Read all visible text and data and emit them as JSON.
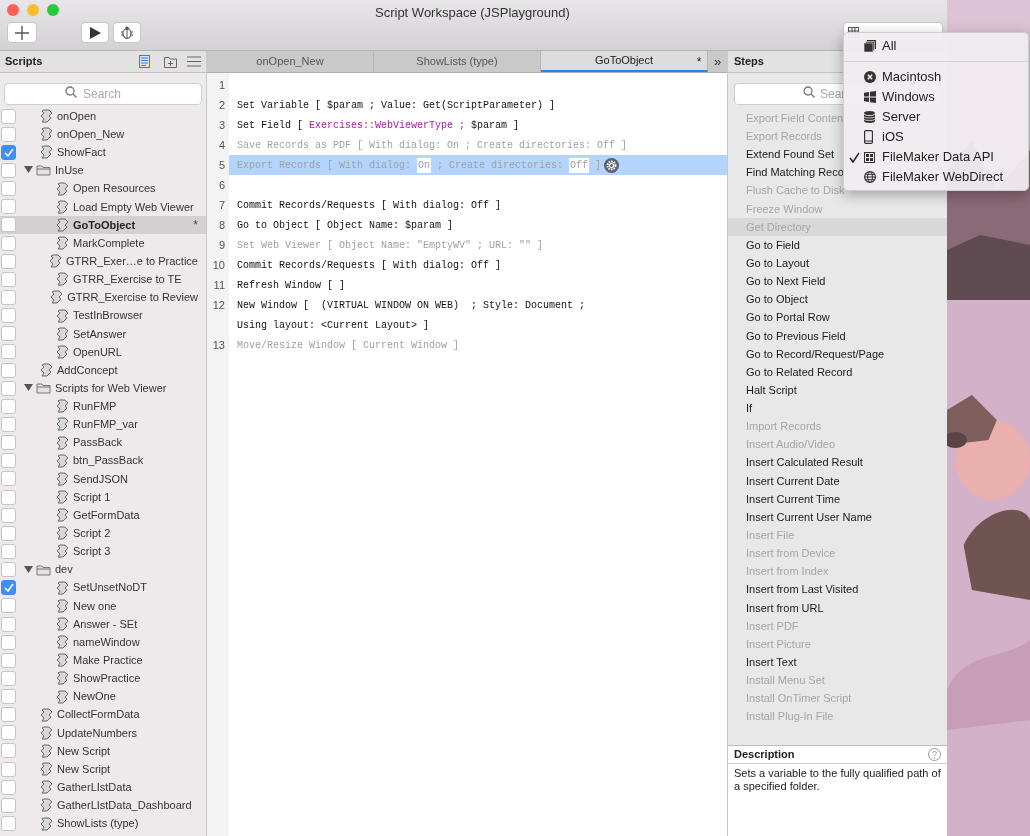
{
  "window": {
    "title": "Script Workspace (JSPlayground)"
  },
  "sidebar": {
    "title": "Scripts",
    "search": {
      "placeholder": "Search"
    },
    "items": [
      {
        "kind": "script",
        "name": "onOpen",
        "checked": false,
        "selected": false
      },
      {
        "kind": "script",
        "name": "onOpen_New",
        "checked": false,
        "selected": false
      },
      {
        "kind": "script",
        "name": "ShowFact",
        "checked": true,
        "selected": false
      },
      {
        "kind": "folder",
        "name": "InUse",
        "checked": false,
        "selected": false,
        "expanded": true,
        "children": [
          {
            "kind": "script",
            "name": "Open Resources",
            "checked": false,
            "selected": false
          },
          {
            "kind": "script",
            "name": "Load Empty Web Viewer",
            "checked": false,
            "selected": false
          },
          {
            "kind": "script",
            "name": "GoToObject",
            "checked": false,
            "selected": true,
            "mark": "*"
          },
          {
            "kind": "script",
            "name": "MarkComplete",
            "checked": false,
            "selected": false
          },
          {
            "kind": "script",
            "name": "GTRR_Exer…e to Practice",
            "checked": false,
            "selected": false
          },
          {
            "kind": "script",
            "name": "GTRR_Exercise to TE",
            "checked": false,
            "selected": false
          },
          {
            "kind": "script",
            "name": "GTRR_Exercise to Review",
            "checked": false,
            "selected": false
          },
          {
            "kind": "script",
            "name": "TestInBrowser",
            "checked": false,
            "selected": false
          },
          {
            "kind": "script",
            "name": "SetAnswer",
            "checked": false,
            "selected": false
          },
          {
            "kind": "script",
            "name": "OpenURL",
            "checked": false,
            "selected": false
          }
        ]
      },
      {
        "kind": "script",
        "name": "AddConcept",
        "checked": false,
        "selected": false
      },
      {
        "kind": "folder",
        "name": "Scripts for Web Viewer",
        "checked": false,
        "selected": false,
        "expanded": true,
        "children": [
          {
            "kind": "script",
            "name": "RunFMP",
            "checked": false,
            "selected": false
          },
          {
            "kind": "script",
            "name": "RunFMP_var",
            "checked": false,
            "selected": false
          },
          {
            "kind": "script",
            "name": "PassBack",
            "checked": false,
            "selected": false
          },
          {
            "kind": "script",
            "name": "btn_PassBack",
            "checked": false,
            "selected": false
          },
          {
            "kind": "script",
            "name": "SendJSON",
            "checked": false,
            "selected": false
          },
          {
            "kind": "script",
            "name": "Script 1",
            "checked": false,
            "selected": false
          },
          {
            "kind": "script",
            "name": "GetFormData",
            "checked": false,
            "selected": false
          },
          {
            "kind": "script",
            "name": "Script 2",
            "checked": false,
            "selected": false
          },
          {
            "kind": "script",
            "name": "Script 3",
            "checked": false,
            "selected": false
          }
        ]
      },
      {
        "kind": "folder",
        "name": "dev",
        "checked": false,
        "selected": false,
        "expanded": true,
        "children": [
          {
            "kind": "script",
            "name": "SetUnsetNoDT",
            "checked": true,
            "selected": false
          },
          {
            "kind": "script",
            "name": "New one",
            "checked": false,
            "selected": false
          },
          {
            "kind": "script",
            "name": "Answer - SEt",
            "checked": false,
            "selected": false
          },
          {
            "kind": "script",
            "name": "nameWindow",
            "checked": false,
            "selected": false
          },
          {
            "kind": "script",
            "name": "Make Practice",
            "checked": false,
            "selected": false
          },
          {
            "kind": "script",
            "name": "ShowPractice",
            "checked": false,
            "selected": false
          },
          {
            "kind": "script",
            "name": "NewOne",
            "checked": false,
            "selected": false
          }
        ]
      },
      {
        "kind": "script",
        "name": "CollectFormData",
        "checked": false,
        "selected": false
      },
      {
        "kind": "script",
        "name": "UpdateNumbers",
        "checked": false,
        "selected": false
      },
      {
        "kind": "script",
        "name": "New Script",
        "checked": false,
        "selected": false
      },
      {
        "kind": "script",
        "name": "New Script",
        "checked": false,
        "selected": false
      },
      {
        "kind": "script",
        "name": "GatherLIstData",
        "checked": false,
        "selected": false
      },
      {
        "kind": "script",
        "name": "GatherLIstData_Dashboard",
        "checked": false,
        "selected": false
      },
      {
        "kind": "script",
        "name": "ShowLists (type)",
        "checked": false,
        "selected": false
      }
    ]
  },
  "tabs": [
    {
      "label": "onOpen_New",
      "selected": false
    },
    {
      "label": "ShowLists (type)",
      "selected": false
    },
    {
      "label": "GoToObject",
      "selected": true,
      "mark": "*"
    }
  ],
  "tabs_overflow": "»",
  "editor": {
    "lines": [
      {
        "number": "1",
        "selected": false,
        "rows": [
          []
        ]
      },
      {
        "number": "2",
        "disabled": false,
        "selected": false,
        "rows": [
          [
            {
              "kind": "plain",
              "text": "Set Variable [ $param ; Value: Get(ScriptParameter) ]"
            }
          ]
        ]
      },
      {
        "number": "3",
        "disabled": false,
        "selected": false,
        "rows": [
          [
            {
              "kind": "plain",
              "text": "Set Field [ "
            },
            {
              "kind": "field",
              "text": "Exercises::WebViewerType ;"
            },
            {
              "kind": "plain",
              "text": " $param ]"
            }
          ]
        ]
      },
      {
        "number": "4",
        "disabled": true,
        "selected": false,
        "rows": [
          [
            {
              "kind": "plain",
              "text": "Save Records as PDF [ With dialog: On ; Create directories: Off ]"
            }
          ]
        ]
      },
      {
        "number": "5",
        "disabled": true,
        "selected": true,
        "rows": [
          [
            {
              "kind": "plain",
              "text": "Export Records [ With dialog: "
            },
            {
              "kind": "option",
              "text": "On"
            },
            {
              "kind": "plain",
              "text": " ; Create directories: "
            },
            {
              "kind": "option",
              "text": "Off"
            },
            {
              "kind": "plain",
              "text": " ]"
            }
          ]
        ]
      },
      {
        "number": "6",
        "selected": false,
        "rows": [
          []
        ]
      },
      {
        "number": "7",
        "disabled": false,
        "selected": false,
        "rows": [
          [
            {
              "kind": "plain",
              "text": "Commit Records/Requests [ With dialog: Off ]"
            }
          ]
        ]
      },
      {
        "number": "8",
        "disabled": false,
        "selected": false,
        "rows": [
          [
            {
              "kind": "plain",
              "text": "Go to Object [ Object Name: $param ]"
            }
          ]
        ]
      },
      {
        "number": "9",
        "disabled": true,
        "selected": false,
        "rows": [
          [
            {
              "kind": "plain",
              "text": "Set Web Viewer [ Object Name: \"EmptyWV\" ; URL: \"\" ]"
            }
          ]
        ]
      },
      {
        "number": "10",
        "disabled": false,
        "selected": false,
        "rows": [
          [
            {
              "kind": "plain",
              "text": "Commit Records/Requests [ With dialog: Off ]"
            }
          ]
        ]
      },
      {
        "number": "11",
        "disabled": false,
        "selected": false,
        "rows": [
          [
            {
              "kind": "plain",
              "text": "Refresh Window [ ]"
            }
          ]
        ]
      },
      {
        "number": "12",
        "disabled": false,
        "selected": false,
        "rows": [
          [
            {
              "kind": "plain",
              "text": "New Window [  (VIRTUAL WINDOW ON WEB)  ; Style: Document ;"
            }
          ],
          [
            {
              "kind": "plain",
              "text": "Using layout: <Current Layout> ]"
            }
          ]
        ]
      },
      {
        "number": "13",
        "disabled": true,
        "selected": false,
        "rows": [
          [
            {
              "kind": "plain",
              "text": "Move/Resize Window [ Current Window ]"
            }
          ]
        ]
      }
    ]
  },
  "steps": {
    "title": "Steps",
    "search": {
      "placeholder": "Sear"
    },
    "items": [
      {
        "label": "Export Field Conten",
        "disabled": true,
        "selected": false
      },
      {
        "label": "Export Records",
        "disabled": true,
        "selected": false
      },
      {
        "label": "Extend Found Set",
        "disabled": false,
        "selected": false
      },
      {
        "label": "Find Matching Reco",
        "disabled": false,
        "selected": false
      },
      {
        "label": "Flush Cache to Disk",
        "disabled": true,
        "selected": false
      },
      {
        "label": "Freeze Window",
        "disabled": true,
        "selected": false
      },
      {
        "label": "Get Directory",
        "disabled": true,
        "selected": true
      },
      {
        "label": "Go to Field",
        "disabled": false,
        "selected": false
      },
      {
        "label": "Go to Layout",
        "disabled": false,
        "selected": false
      },
      {
        "label": "Go to Next Field",
        "disabled": false,
        "selected": false
      },
      {
        "label": "Go to Object",
        "disabled": false,
        "selected": false
      },
      {
        "label": "Go to Portal Row",
        "disabled": false,
        "selected": false
      },
      {
        "label": "Go to Previous Field",
        "disabled": false,
        "selected": false
      },
      {
        "label": "Go to Record/Request/Page",
        "disabled": false,
        "selected": false
      },
      {
        "label": "Go to Related Record",
        "disabled": false,
        "selected": false
      },
      {
        "label": "Halt Script",
        "disabled": false,
        "selected": false
      },
      {
        "label": "If",
        "disabled": false,
        "selected": false
      },
      {
        "label": "Import Records",
        "disabled": true,
        "selected": false
      },
      {
        "label": "Insert Audio/Video",
        "disabled": true,
        "selected": false
      },
      {
        "label": "Insert Calculated Result",
        "disabled": false,
        "selected": false
      },
      {
        "label": "Insert Current Date",
        "disabled": false,
        "selected": false
      },
      {
        "label": "Insert Current Time",
        "disabled": false,
        "selected": false
      },
      {
        "label": "Insert Current User Name",
        "disabled": false,
        "selected": false
      },
      {
        "label": "Insert File",
        "disabled": true,
        "selected": false
      },
      {
        "label": "Insert from Device",
        "disabled": true,
        "selected": false
      },
      {
        "label": "Insert from Index",
        "disabled": true,
        "selected": false
      },
      {
        "label": "Insert from Last Visited",
        "disabled": false,
        "selected": false
      },
      {
        "label": "Insert from URL",
        "disabled": false,
        "selected": false
      },
      {
        "label": "Insert PDF",
        "disabled": true,
        "selected": false
      },
      {
        "label": "Insert Picture",
        "disabled": true,
        "selected": false
      },
      {
        "label": "Insert Text",
        "disabled": false,
        "selected": false
      },
      {
        "label": "Install Menu Set",
        "disabled": true,
        "selected": false
      },
      {
        "label": "Install OnTimer Script",
        "disabled": true,
        "selected": false
      },
      {
        "label": "Install Plug-In File",
        "disabled": true,
        "selected": false
      }
    ]
  },
  "description": {
    "title": "Description",
    "text": "Sets a variable to the fully qualified path of a specified folder."
  },
  "platform_menu": [
    {
      "kind": "all",
      "label": "All",
      "checked": false
    },
    {
      "kind": "separator"
    },
    {
      "kind": "mac",
      "label": "Macintosh",
      "checked": false
    },
    {
      "kind": "windows",
      "label": "Windows",
      "checked": false
    },
    {
      "kind": "server",
      "label": "Server",
      "checked": false
    },
    {
      "kind": "ios",
      "label": "iOS",
      "checked": false
    },
    {
      "kind": "api",
      "label": "FileMaker Data API",
      "checked": true
    },
    {
      "kind": "web",
      "label": "FileMaker WebDirect",
      "checked": false
    }
  ]
}
